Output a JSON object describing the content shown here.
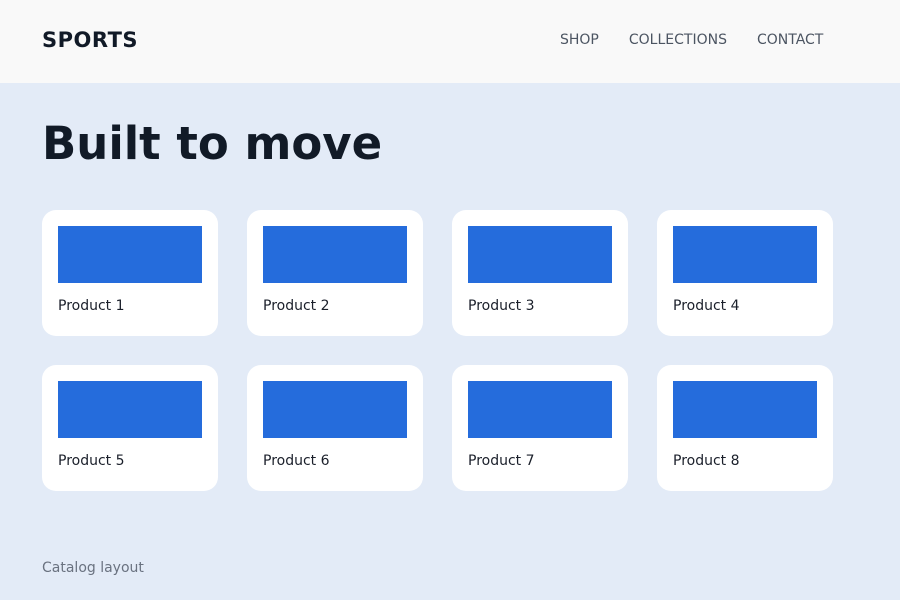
{
  "header": {
    "brand": "SPORTS",
    "nav": [
      "SHOP",
      "COLLECTIONS",
      "CONTACT"
    ]
  },
  "hero": {
    "title": "Built to move"
  },
  "products": [
    {
      "label": "Product 1"
    },
    {
      "label": "Product 2"
    },
    {
      "label": "Product 3"
    },
    {
      "label": "Product 4"
    },
    {
      "label": "Product 5"
    },
    {
      "label": "Product 6"
    },
    {
      "label": "Product 7"
    },
    {
      "label": "Product 8"
    }
  ],
  "footer": {
    "note": "Catalog layout"
  },
  "colors": {
    "background": "#e3ebf7",
    "header_background": "#f9f9f9",
    "accent": "#256cdc",
    "card_background": "#ffffff"
  }
}
